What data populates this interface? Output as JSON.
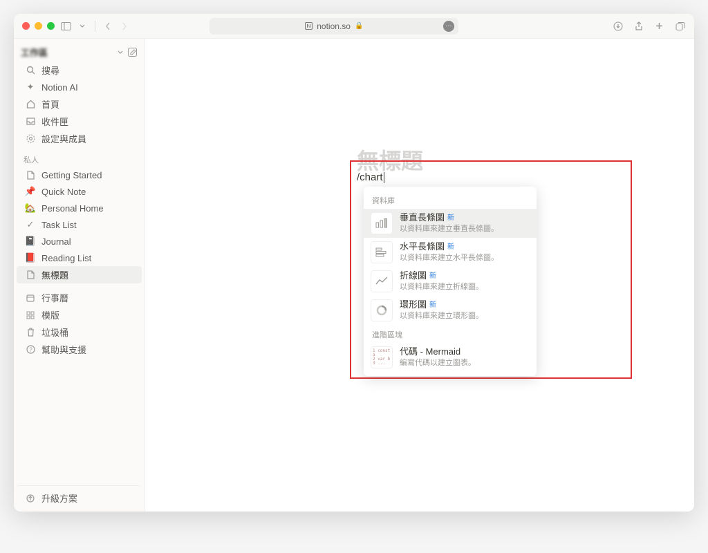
{
  "titlebar": {
    "url": "notion.so"
  },
  "sidebar": {
    "workspace_name": "工作區",
    "top": [
      {
        "icon": "search-icon",
        "label": "搜尋"
      },
      {
        "icon": "sparkle-icon",
        "label": "Notion AI"
      },
      {
        "icon": "home-icon",
        "label": "首頁"
      },
      {
        "icon": "inbox-icon",
        "label": "收件匣"
      },
      {
        "icon": "gear-icon",
        "label": "設定與成員"
      }
    ],
    "section_private": "私人",
    "pages": [
      {
        "icon": "page-icon",
        "label": "Getting Started"
      },
      {
        "icon": "pin-icon",
        "label": "Quick Note"
      },
      {
        "icon": "house-icon",
        "label": "Personal Home"
      },
      {
        "icon": "check-icon",
        "label": "Task List"
      },
      {
        "icon": "book-icon",
        "label": "Journal"
      },
      {
        "icon": "books-icon",
        "label": "Reading List"
      },
      {
        "icon": "page-icon",
        "label": "無標題",
        "active": true
      }
    ],
    "bottom": [
      {
        "icon": "calendar-icon",
        "label": "行事曆"
      },
      {
        "icon": "template-icon",
        "label": "模版"
      },
      {
        "icon": "trash-icon",
        "label": "垃圾桶"
      },
      {
        "icon": "help-icon",
        "label": "幫助與支援"
      }
    ],
    "upgrade": "升級方案"
  },
  "page": {
    "title_placeholder": "無標題",
    "slash_command": "/chart"
  },
  "menu": {
    "section_db": "資料庫",
    "items": [
      {
        "icon": "bar-vertical-icon",
        "title": "垂直長條圖",
        "badge": "新",
        "desc": "以資料庫來建立垂直長條圖。",
        "active": true
      },
      {
        "icon": "bar-horizontal-icon",
        "title": "水平長條圖",
        "badge": "新",
        "desc": "以資料庫來建立水平長條圖。"
      },
      {
        "icon": "line-chart-icon",
        "title": "折線圖",
        "badge": "新",
        "desc": "以資料庫來建立折線圖。"
      },
      {
        "icon": "donut-chart-icon",
        "title": "環形圖",
        "badge": "新",
        "desc": "以資料庫來建立環形圖。"
      }
    ],
    "section_advanced": "進階區塊",
    "advanced": [
      {
        "icon": "code-icon",
        "title": "代碼 - Mermaid",
        "desc": "編寫代碼以建立圖表。"
      }
    ]
  }
}
